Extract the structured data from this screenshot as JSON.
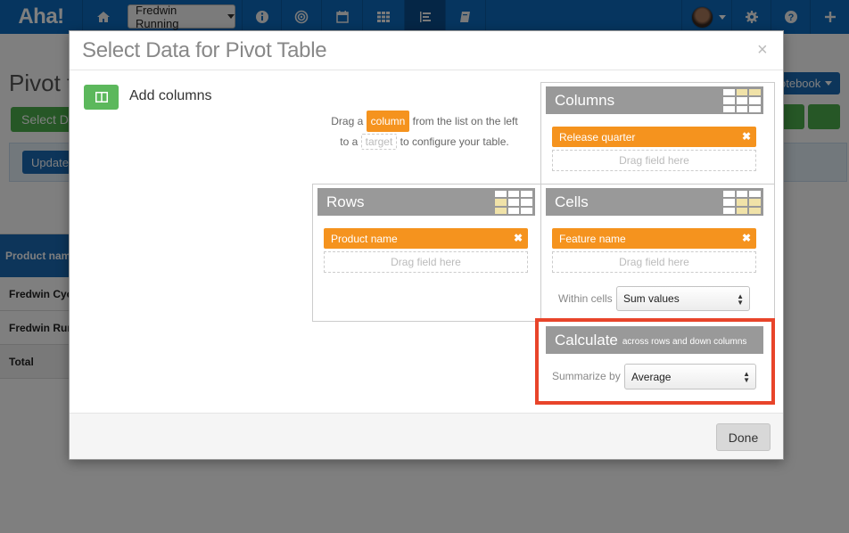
{
  "app": {
    "logo": "Aha!",
    "workspace": "Fredwin Running",
    "nav_icons": [
      "home-icon",
      "info-icon",
      "target-icon",
      "calendar-icon",
      "grid-icon",
      "report-icon",
      "notebook-icon"
    ],
    "right_icons": [
      "avatar",
      "gear-icon",
      "help-icon",
      "plus-icon"
    ]
  },
  "page": {
    "title": "Pivot ta",
    "select_data_label": "Select D",
    "notebook_label": "otebook",
    "update_label": "Update",
    "table": {
      "header": "Product nam",
      "rows": [
        "Fredwin Cyc",
        "Fredwin Run",
        "Total"
      ]
    }
  },
  "modal": {
    "title": "Select Data for Pivot Table",
    "close": "×",
    "add_columns": "Add columns",
    "hint": {
      "drag": "Drag a",
      "column_chip": "column",
      "from_list": "from the list on the left",
      "to_a": "to a",
      "target_chip": "target",
      "to_configure": "to configure your table."
    },
    "columns": {
      "title": "Columns",
      "field": "Release quarter",
      "drop": "Drag field here"
    },
    "rows": {
      "title": "Rows",
      "field": "Product name",
      "drop": "Drag field here"
    },
    "cells": {
      "title": "Cells",
      "field": "Feature name",
      "drop": "Drag field here",
      "within_label": "Within cells",
      "within_value": "Sum values"
    },
    "calculate": {
      "title": "Calculate",
      "subtitle": "across rows and down columns",
      "summarize_label": "Summarize by",
      "summarize_value": "Average"
    },
    "done": "Done",
    "remove_symbol": "✖"
  },
  "colors": {
    "topbar": "#0c6bbf",
    "pill": "#f5931e",
    "highlight": "#e8442a",
    "green": "#5cb85c"
  }
}
